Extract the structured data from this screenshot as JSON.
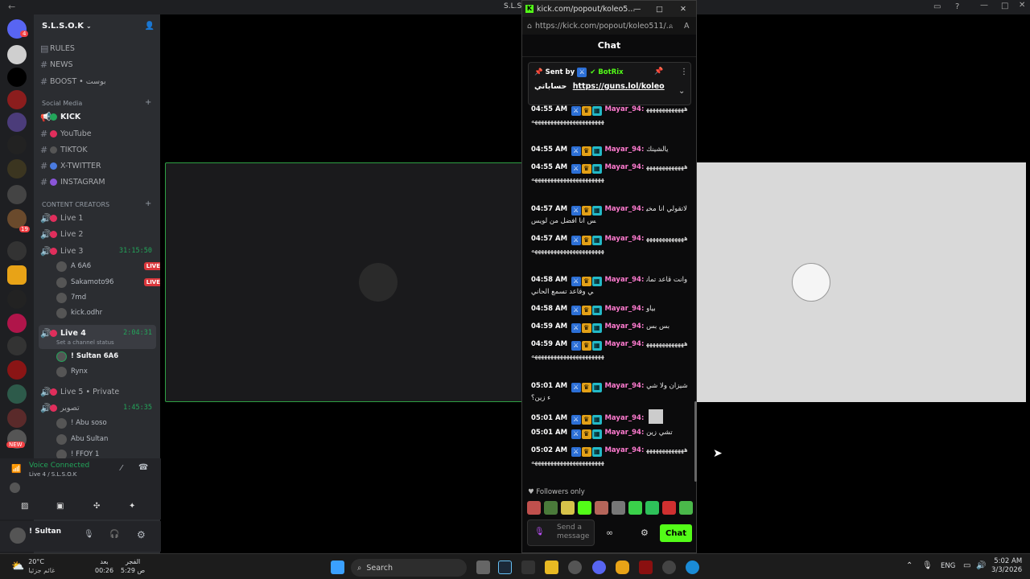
{
  "window": {
    "title": "S.L.S.O.K"
  },
  "server": {
    "name": "S.L.S.O.K",
    "notif_count": "4",
    "notif_count2": "19",
    "new_badge": "NEW"
  },
  "channels": {
    "top": [
      {
        "label": "RULES"
      },
      {
        "label": "NEWS"
      },
      {
        "label": "BOOST • بوست"
      }
    ],
    "social_cat": "Social Media",
    "social": [
      {
        "label": "KICK",
        "color": "#53fc18"
      },
      {
        "label": "YouTube",
        "color": "#e02e5c"
      },
      {
        "label": "TIKTOK",
        "color": "#555555"
      },
      {
        "label": "X-TWITTER",
        "color": "#4a7be0"
      },
      {
        "label": "INSTAGRAM",
        "color": "#8a55d8"
      }
    ],
    "creators_cat": "CONTENT CREATORS",
    "voice": [
      {
        "label": "Live 1"
      },
      {
        "label": "Live 2"
      },
      {
        "label": "Live 3",
        "timer": "31:15:50"
      }
    ],
    "live3_users": [
      {
        "name": "A  6A6",
        "live": "LIVE"
      },
      {
        "name": "Sakamoto96",
        "live": "LIVE"
      },
      {
        "name": "7md"
      },
      {
        "name": "kick.odhr"
      }
    ],
    "live4": {
      "label": "Live 4",
      "timer": "2:04:31",
      "status": "Set a channel status"
    },
    "live4_users": [
      {
        "name": "! Sultan  6A6"
      },
      {
        "name": "Rynx"
      }
    ],
    "live5": {
      "label": "Live 5 • Private"
    },
    "tasweer": {
      "label": "تصوير",
      "timer": "1:45:35"
    },
    "tasweer_users": [
      {
        "name": "! Abu soso"
      },
      {
        "name": "Abu Sultan"
      },
      {
        "name": "! FFOY 1"
      }
    ]
  },
  "voice": {
    "status": "Voice Connected",
    "channel": "Live 4 / S.L.S.O.K"
  },
  "userpanel": {
    "name": "! Sultan"
  },
  "popup": {
    "title": "kick.com/popout/koleo5...",
    "url": "https://kick.com/popout/koleo511/...",
    "header": "Chat"
  },
  "pinned": {
    "sent_by": "Sent by",
    "bot": "BotRix",
    "text": "حساباتي",
    "link": "https://guns.lol/koleo"
  },
  "messages": [
    {
      "time": "04:55 AM",
      "user": "Mayar_94:",
      "text": "هههههههههههههههههههههههههههههههههههه"
    },
    {
      "time": "04:55 AM",
      "user": "Mayar_94:",
      "text": "يالشينك"
    },
    {
      "time": "04:55 AM",
      "user": "Mayar_94:",
      "text": "هههههههههههههههههههههههههههههههههههه"
    },
    {
      "time": "04:57 AM",
      "user": "Mayar_94:",
      "text": "لاتقولي انا مخيس انا افضل من لويس"
    },
    {
      "time": "04:57 AM",
      "user": "Mayar_94:",
      "text": "هههههههههههههههههههههههههههههههههههه"
    },
    {
      "time": "04:58 AM",
      "user": "Mayar_94:",
      "text": "وانت قاعد تماني وقاعد تسمع الحاني"
    },
    {
      "time": "04:58 AM",
      "user": "Mayar_94:",
      "text": "بياو"
    },
    {
      "time": "04:59 AM",
      "user": "Mayar_94:",
      "text": "بس بس"
    },
    {
      "time": "04:59 AM",
      "user": "Mayar_94:",
      "text": "هههههههههههههههههههههههههههههههههههه"
    },
    {
      "time": "05:01 AM",
      "user": "Mayar_94:",
      "text": "شيزان ولا شيء زين؟"
    },
    {
      "time": "05:01 AM",
      "user": "Mayar_94:",
      "text": ""
    },
    {
      "time": "05:01 AM",
      "user": "Mayar_94:",
      "text": "تشي زين"
    },
    {
      "time": "05:02 AM",
      "user": "Mayar_94:",
      "text": "هههههههههههههههههههههههههههههههههههه"
    }
  ],
  "followers_only": "Followers only",
  "input": {
    "placeholder": "Send a message"
  },
  "chat_button": "Chat",
  "taskbar": {
    "search": "Search",
    "weather_temp": "20°C",
    "weather_desc": "غائم جزئيا",
    "prayer1_name": "بعد",
    "prayer1_time": "00:26",
    "prayer2_name": "الفجر",
    "prayer2_time": "5:29 ص",
    "lang": "ENG",
    "time": "5:02 AM",
    "date": "3/3/2026"
  }
}
